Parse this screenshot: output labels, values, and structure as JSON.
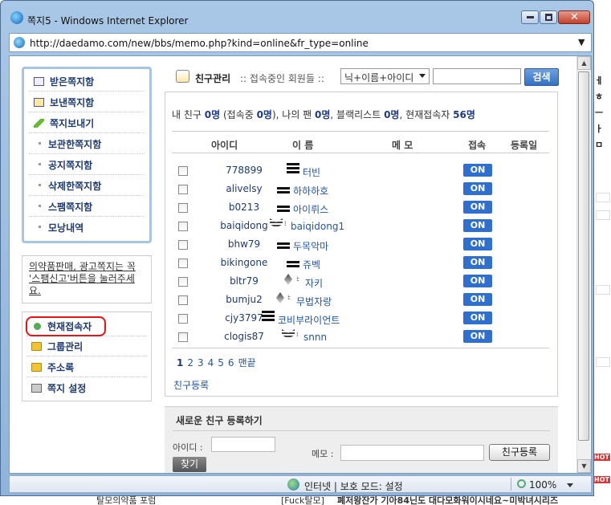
{
  "window": {
    "title": "쪽지5 - Windows Internet Explorer",
    "url": "http://daedamo.com/new/bbs/memo.php?kind=online&fr_type=online"
  },
  "sidebar": {
    "items": [
      {
        "label": "받은쪽지함"
      },
      {
        "label": "보낸쪽지함"
      },
      {
        "label": "쪽지보내기"
      },
      {
        "label": "보관한쪽지함"
      },
      {
        "label": "공지쪽지함"
      },
      {
        "label": "삭제한쪽지함"
      },
      {
        "label": "스팸쪽지함"
      },
      {
        "label": "모낭내역"
      }
    ],
    "notice": "의약품판매, 광고쪽지는 꼭 '스팸신고'버튼을 눌러주세요.",
    "items2": [
      {
        "label": "현재접속자"
      },
      {
        "label": "그룹관리"
      },
      {
        "label": "주소록"
      },
      {
        "label": "쪽지 설정"
      }
    ]
  },
  "main": {
    "title": "친구관리",
    "subtitle": ":: 접속중인 회원들 ::",
    "search_select": "닉+이름+아이디",
    "search_button": "검색",
    "stats": {
      "p1": "내 친구 ",
      "friends": "0명",
      "p2": " (접속중 ",
      "online": "0명",
      "p3": "), 나의 팬 ",
      "fans": "0명",
      "p4": ", 블랙리스트 ",
      "blacklist": "0명",
      "p5": ", 현재접속자 ",
      "current": "56명"
    },
    "columns": {
      "id": "아이디",
      "name": "이 름",
      "memo": "메 모",
      "status": "접속",
      "date": "등록일"
    },
    "rows": [
      {
        "id": "778899",
        "name": "터빈",
        "status": "ON"
      },
      {
        "id": "alivelsy",
        "name": "하하하호",
        "status": "ON"
      },
      {
        "id": "b0213",
        "name": "아이뤼스",
        "status": "ON"
      },
      {
        "id": "baiqidong",
        "name": "baiqidong1",
        "status": "ON"
      },
      {
        "id": "bhw79",
        "name": "두목악마",
        "status": "ON"
      },
      {
        "id": "bikingone",
        "name": "쥬벡",
        "status": "ON"
      },
      {
        "id": "bltr79",
        "name": "자키",
        "status": "ON"
      },
      {
        "id": "bumju2",
        "name": "무법자랑",
        "status": "ON"
      },
      {
        "id": "cjy3797",
        "name": "코비부라이언트",
        "status": "ON"
      },
      {
        "id": "clogis87",
        "name": "snnn",
        "status": "ON"
      }
    ],
    "pages": [
      "1",
      "2",
      "3",
      "4",
      "5",
      "6"
    ],
    "last_page": "맨끝",
    "friend_register_link": "친구등록"
  },
  "register": {
    "title": "새로운 친구 등록하기",
    "id_label": "아이디 :",
    "find_button": "찾기",
    "memo_label": "메모 :",
    "register_button": "친구등록"
  },
  "statusbar": {
    "zone": "인터넷 | 보호 모드: 설정",
    "zoom": "100%"
  },
  "background": {
    "bottom_text": "탈모의약품 포럼",
    "bottom_tag": "[Fuck탈모]",
    "bottom_title": "폐저왕잔가 기아84닌도 대다모화워이시네요~미박녀시리즈"
  }
}
